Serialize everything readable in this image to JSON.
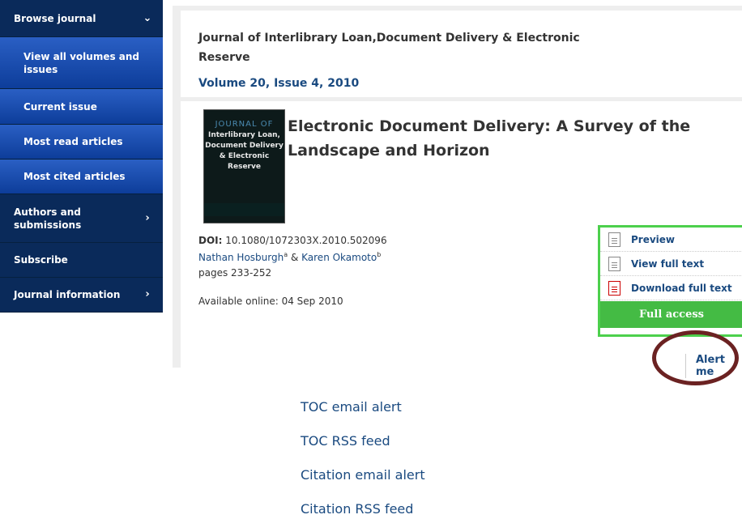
{
  "sidebar": {
    "items": [
      {
        "label": "Browse journal",
        "chevron": "⌄"
      },
      {
        "label": "View all volumes and issues"
      },
      {
        "label": "Current issue"
      },
      {
        "label": "Most read articles"
      },
      {
        "label": "Most cited articles"
      },
      {
        "label": "Authors and submissions",
        "chevron": "›"
      },
      {
        "label": "Subscribe"
      },
      {
        "label": "Journal information",
        "chevron": "›"
      }
    ]
  },
  "journal": {
    "title": "Journal of Interlibrary Loan,Document Delivery & Electronic Reserve",
    "volume": "Volume 20, Issue 4, 2010"
  },
  "cover": {
    "line1": "JOURNAL OF",
    "line2": "Interlibrary Loan, Document Delivery & Electronic Reserve"
  },
  "article": {
    "title": "Electronic Document Delivery: A Survey of the Landscape and Horizon",
    "doi_label": "DOI:",
    "doi": "10.1080/1072303X.2010.502096",
    "author1": "Nathan Hosburgh",
    "author1_sup": "a",
    "author_sep": "&",
    "author2": "Karen Okamoto",
    "author2_sup": "b",
    "pages": "pages 233-252",
    "available": "Available online: 04 Sep 2010"
  },
  "access": {
    "preview": "Preview",
    "view_full_text": "View full text",
    "download_full_text": "Download full text",
    "full_access": "Full access",
    "icons": [
      "document-icon",
      "document-icon",
      "pdf-icon"
    ]
  },
  "alert": {
    "label": "Alert me",
    "options": [
      "TOC email alert",
      "TOC RSS feed",
      "Citation email alert",
      "Citation RSS feed"
    ]
  }
}
